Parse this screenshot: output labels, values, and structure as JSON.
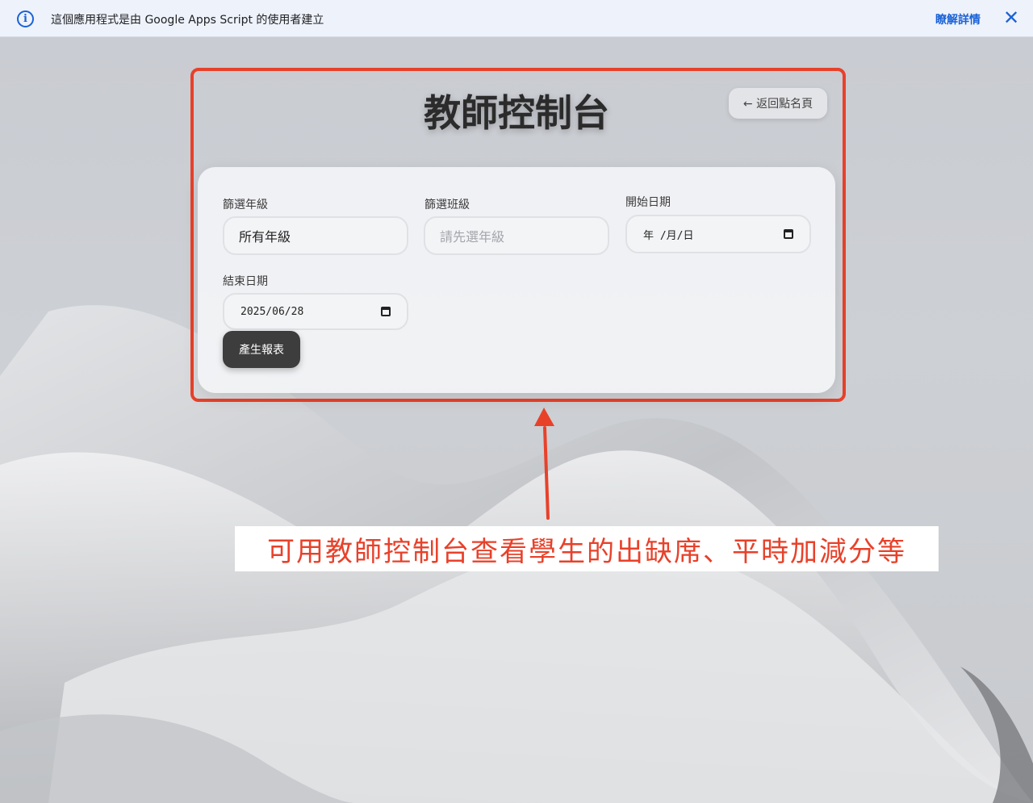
{
  "banner": {
    "message": "這個應用程式是由 Google Apps Script 的使用者建立",
    "learn_more": "瞭解詳情",
    "close_glyph": "✕",
    "info_glyph": "i"
  },
  "header": {
    "title": "教師控制台",
    "back_label": "← 返回點名頁"
  },
  "filters": {
    "grade_label": "篩選年級",
    "grade_value": "所有年級",
    "class_label": "篩選班級",
    "class_placeholder": "請先選年級",
    "start_label": "開始日期",
    "start_value": "年 /月/日",
    "end_label": "結束日期",
    "end_value": "2025/06/28"
  },
  "actions": {
    "generate_label": "產生報表"
  },
  "annotation": {
    "note": "可用教師控制台查看學生的出缺席、平時加減分等",
    "color": "#e8412a"
  }
}
